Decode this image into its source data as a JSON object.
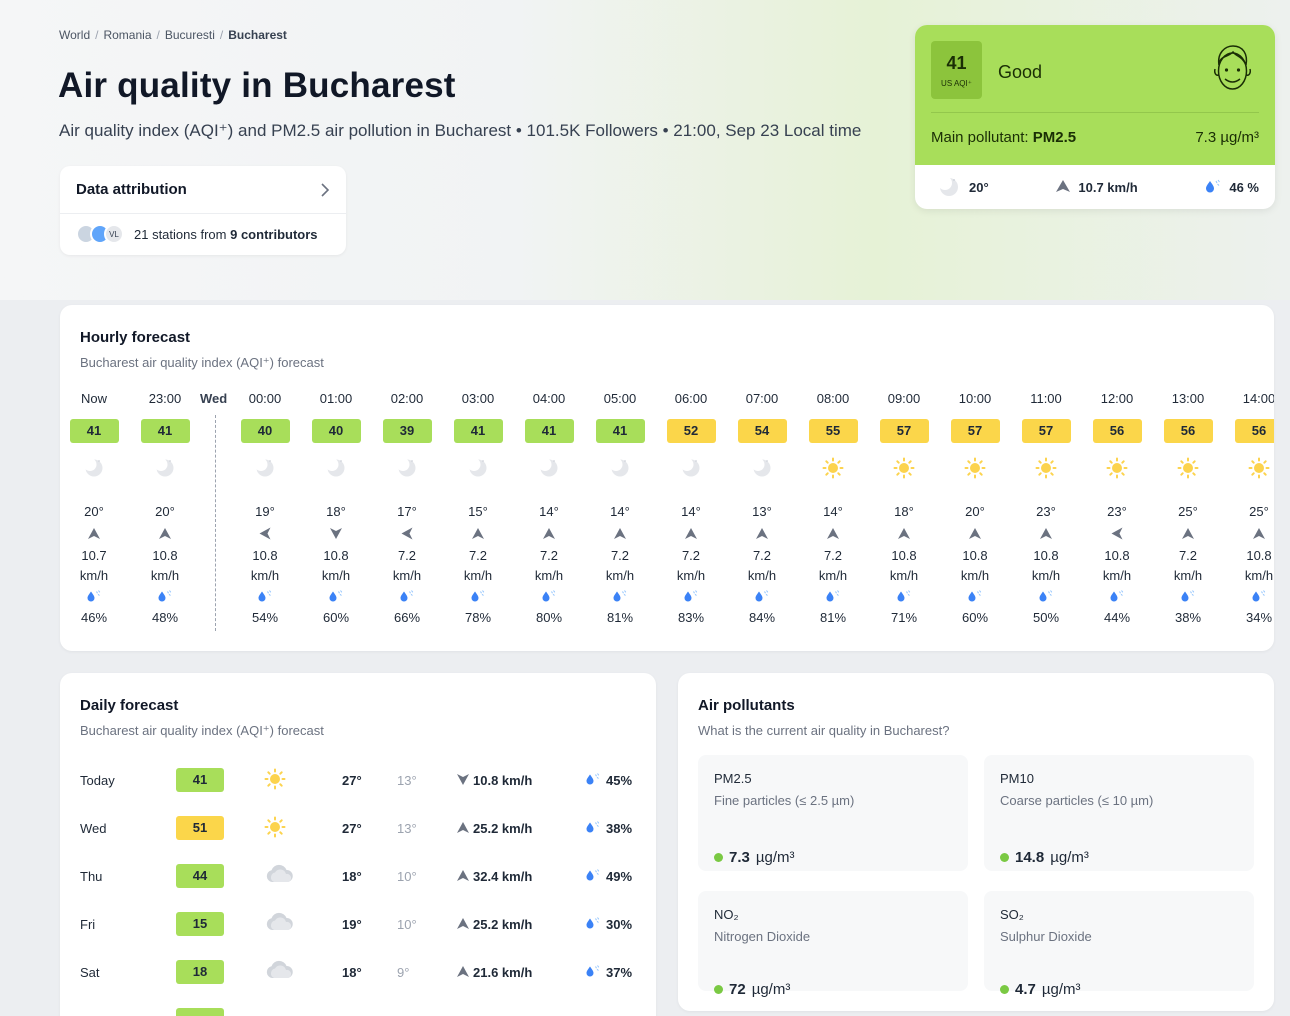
{
  "breadcrumb": [
    "World",
    "Romania",
    "Bucuresti",
    "Bucharest"
  ],
  "page_title": "Air quality in Bucharest",
  "subtitle": "Air quality index (AQI⁺) and PM2.5 air pollution in Bucharest • 101.5K Followers • 21:00, Sep 23 Local time",
  "attribution": {
    "title": "Data attribution",
    "logo_label": "VL",
    "text_prefix": "21 stations from ",
    "text_bold": "9 contributors"
  },
  "aqi": {
    "value": "41",
    "unit": "US AQI⁺",
    "level": "Good",
    "pollutant_label": "Main pollutant: ",
    "pollutant": "PM2.5",
    "concentration": "7.3 µg/m³",
    "temp": "20°",
    "wind": "10.7 km/h",
    "humidity": "46 %",
    "colors": {
      "good": "#a8de5a",
      "moderate": "#fbd64a"
    }
  },
  "hourly": {
    "title": "Hourly forecast",
    "subtitle": "Bucharest air quality index (AQI⁺) forecast",
    "day_label": "Wed",
    "wind_unit": "km/h",
    "items": [
      {
        "time": "Now",
        "aqi": "41",
        "level": "good",
        "icon": "moon-icon",
        "temp": "20°",
        "wind_dir": "up",
        "wind": "10.7",
        "hum": "46%"
      },
      {
        "time": "23:00",
        "aqi": "41",
        "level": "good",
        "icon": "moon-icon",
        "temp": "20°",
        "wind_dir": "up",
        "wind": "10.8",
        "hum": "48%"
      },
      {
        "time": "00:00",
        "aqi": "40",
        "level": "good",
        "icon": "moon-icon",
        "temp": "19°",
        "wind_dir": "left",
        "wind": "10.8",
        "hum": "54%"
      },
      {
        "time": "01:00",
        "aqi": "40",
        "level": "good",
        "icon": "moon-icon",
        "temp": "18°",
        "wind_dir": "down",
        "wind": "10.8",
        "hum": "60%"
      },
      {
        "time": "02:00",
        "aqi": "39",
        "level": "good",
        "icon": "moon-icon",
        "temp": "17°",
        "wind_dir": "left",
        "wind": "7.2",
        "hum": "66%"
      },
      {
        "time": "03:00",
        "aqi": "41",
        "level": "good",
        "icon": "moon-icon",
        "temp": "15°",
        "wind_dir": "up",
        "wind": "7.2",
        "hum": "78%"
      },
      {
        "time": "04:00",
        "aqi": "41",
        "level": "good",
        "icon": "moon-icon",
        "temp": "14°",
        "wind_dir": "up",
        "wind": "7.2",
        "hum": "80%"
      },
      {
        "time": "05:00",
        "aqi": "41",
        "level": "good",
        "icon": "moon-icon",
        "temp": "14°",
        "wind_dir": "up",
        "wind": "7.2",
        "hum": "81%"
      },
      {
        "time": "06:00",
        "aqi": "52",
        "level": "moderate",
        "icon": "moon-icon",
        "temp": "14°",
        "wind_dir": "up",
        "wind": "7.2",
        "hum": "83%"
      },
      {
        "time": "07:00",
        "aqi": "54",
        "level": "moderate",
        "icon": "moon-icon",
        "temp": "13°",
        "wind_dir": "up",
        "wind": "7.2",
        "hum": "84%"
      },
      {
        "time": "08:00",
        "aqi": "55",
        "level": "moderate",
        "icon": "sun-icon",
        "temp": "14°",
        "wind_dir": "up",
        "wind": "7.2",
        "hum": "81%"
      },
      {
        "time": "09:00",
        "aqi": "57",
        "level": "moderate",
        "icon": "sun-icon",
        "temp": "18°",
        "wind_dir": "up",
        "wind": "10.8",
        "hum": "71%"
      },
      {
        "time": "10:00",
        "aqi": "57",
        "level": "moderate",
        "icon": "sun-icon",
        "temp": "20°",
        "wind_dir": "up",
        "wind": "10.8",
        "hum": "60%"
      },
      {
        "time": "11:00",
        "aqi": "57",
        "level": "moderate",
        "icon": "sun-icon",
        "temp": "23°",
        "wind_dir": "up",
        "wind": "10.8",
        "hum": "50%"
      },
      {
        "time": "12:00",
        "aqi": "56",
        "level": "moderate",
        "icon": "sun-icon",
        "temp": "23°",
        "wind_dir": "left",
        "wind": "10.8",
        "hum": "44%"
      },
      {
        "time": "13:00",
        "aqi": "56",
        "level": "moderate",
        "icon": "sun-icon",
        "temp": "25°",
        "wind_dir": "up",
        "wind": "7.2",
        "hum": "38%"
      },
      {
        "time": "14:00",
        "aqi": "56",
        "level": "moderate",
        "icon": "sun-icon",
        "temp": "25°",
        "wind_dir": "up",
        "wind": "10.8",
        "hum": "34%"
      }
    ]
  },
  "daily": {
    "title": "Daily forecast",
    "subtitle": "Bucharest air quality index (AQI⁺) forecast",
    "items": [
      {
        "day": "Today",
        "aqi": "41",
        "level": "good",
        "icon": "sun-icon",
        "hi": "27°",
        "lo": "13°",
        "wind_dir": "down",
        "wind": "10.8 km/h",
        "hum": "45%"
      },
      {
        "day": "Wed",
        "aqi": "51",
        "level": "moderate",
        "icon": "sun-icon",
        "hi": "27°",
        "lo": "13°",
        "wind_dir": "up",
        "wind": "25.2 km/h",
        "hum": "38%"
      },
      {
        "day": "Thu",
        "aqi": "44",
        "level": "good",
        "icon": "cloud-icon",
        "hi": "18°",
        "lo": "10°",
        "wind_dir": "up",
        "wind": "32.4 km/h",
        "hum": "49%"
      },
      {
        "day": "Fri",
        "aqi": "15",
        "level": "good",
        "icon": "cloud-icon",
        "hi": "19°",
        "lo": "10°",
        "wind_dir": "up",
        "wind": "25.2 km/h",
        "hum": "30%"
      },
      {
        "day": "Sat",
        "aqi": "18",
        "level": "good",
        "icon": "cloud-icon",
        "hi": "18°",
        "lo": "9°",
        "wind_dir": "up",
        "wind": "21.6 km/h",
        "hum": "37%"
      }
    ]
  },
  "pollutants": {
    "title": "Air pollutants",
    "subtitle": "What is the current air quality in Bucharest?",
    "items": [
      {
        "name": "PM2.5",
        "desc": "Fine particles (≤ 2.5 µm)",
        "value": "7.3",
        "unit": "µg/m³"
      },
      {
        "name": "PM10",
        "desc": "Coarse particles (≤ 10 µm)",
        "value": "14.8",
        "unit": "µg/m³"
      },
      {
        "name": "NO₂",
        "desc": "Nitrogen Dioxide",
        "value": "72",
        "unit": "µg/m³"
      },
      {
        "name": "SO₂",
        "desc": "Sulphur Dioxide",
        "value": "4.7",
        "unit": "µg/m³"
      }
    ]
  }
}
